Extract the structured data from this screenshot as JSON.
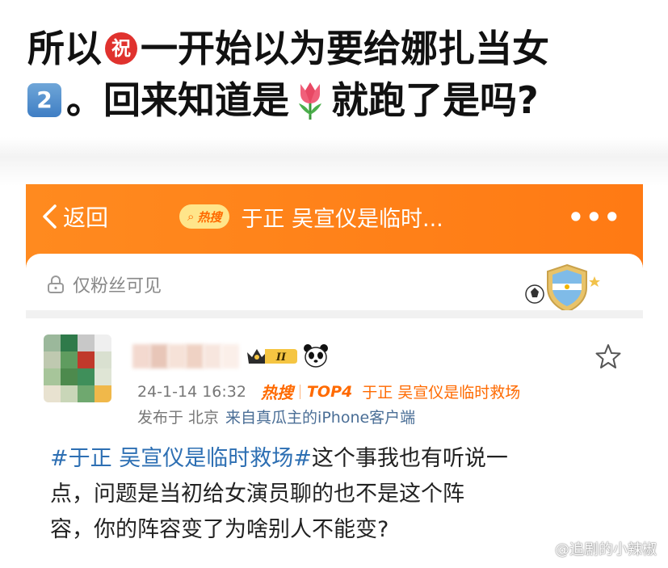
{
  "caption": {
    "line1_before": "所以",
    "zhu_emoji": "祝",
    "line1_after": "一开始以为要给娜扎当女",
    "two_emoji": "2",
    "line2": "。回来知道是",
    "line2_end": "就跑了是吗?"
  },
  "header": {
    "back_label": "返回",
    "hot_label": "热搜",
    "title": "于正 吴宣仪是临时...",
    "more_label": "•••"
  },
  "visibility": {
    "label": "仅粉丝可见"
  },
  "post": {
    "vip_level": "II",
    "time": "24-1-14 16:32",
    "hot_label": "热搜",
    "top_label": "TOP4",
    "topic": "于正 吴宣仪是临时救场",
    "from_label": "发布于 北京",
    "source": "来自真瓜主的iPhone客户端",
    "body_tag": "#于正 吴宣仪是临时救场#",
    "body_line1": "这个事我也有听说一",
    "body_line2": "点，问题是当初给女演员聊的也不是这个阵",
    "body_line3": "容，你的阵容变了为啥别人不能变?"
  },
  "watermark": {
    "text": "@追剧的小辣椒"
  },
  "colors": {
    "accent_orange": "#ff7a14",
    "link_blue": "#2d6fb3",
    "hot_orange": "#ff6a00"
  }
}
